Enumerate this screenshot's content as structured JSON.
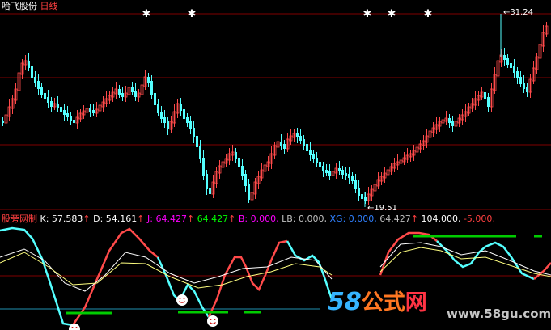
{
  "window": {
    "stock_name": "哈飞股份",
    "period": "日线"
  },
  "price_panel": {
    "high_label": "31.24",
    "low_label": "19.51"
  },
  "indicator_panel": {
    "name": "股旁网制",
    "values": [
      {
        "label": "K:",
        "value": "57.583",
        "arrow": "↑",
        "color": "#ffffff"
      },
      {
        "label": "D:",
        "value": "54.161",
        "arrow": "↑",
        "color": "#ffffff"
      },
      {
        "label": "J:",
        "value": "64.427",
        "arrow": "↑",
        "color": "#ff00ff"
      },
      {
        "label": "",
        "value": "64.427",
        "arrow": "↑",
        "color": "#00ff00"
      },
      {
        "label": "B:",
        "value": "0.000",
        "arrow": ",",
        "color": "#ff00ff"
      },
      {
        "label": "LB:",
        "value": "0.000",
        "arrow": ",",
        "color": "#c0c0c0"
      },
      {
        "label": "XG:",
        "value": "0.000",
        "arrow": ",",
        "color": "#3080ff"
      },
      {
        "label": "",
        "value": "64.427",
        "arrow": "↑",
        "color": "#c0c0c0"
      },
      {
        "label": "",
        "value": "104.000",
        "arrow": ",",
        "color": "#ffffff"
      },
      {
        "label": "",
        "value": "-5.000",
        "arrow": ",",
        "color": "#ff4040"
      }
    ]
  },
  "watermark": {
    "brand_num": "58",
    "brand_cn": "公式",
    "brand_net": "网",
    "url": "www.58gu.com"
  },
  "colors": {
    "up": "#ff4a4a",
    "down": "#54ffff",
    "grid": "#800000",
    "k_line": "#ffffff",
    "d_line": "#ffff80",
    "signal": "#00cc00"
  },
  "icons": [
    "star-marker-icon",
    "smiley-marker-icon",
    "arrow-pointer-icon"
  ]
}
